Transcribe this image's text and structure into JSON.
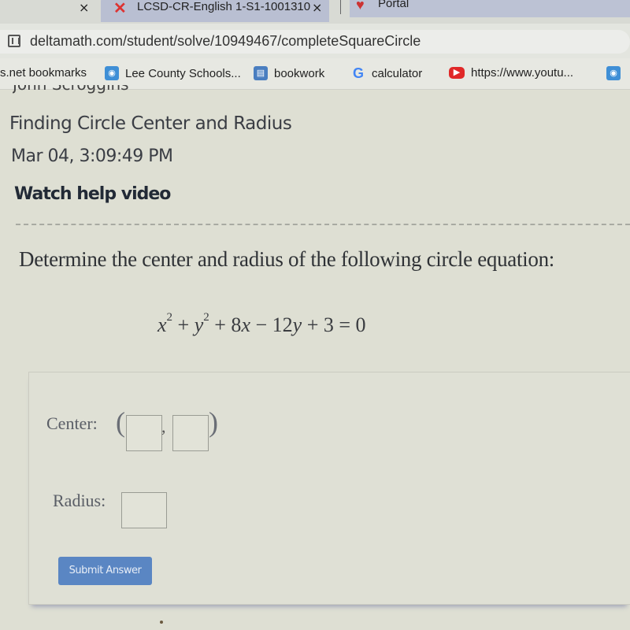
{
  "browser": {
    "tabs": [
      {
        "label": "LCSD-CR-English 1-S1-1001310",
        "icon": "x-logo-icon",
        "active": true
      },
      {
        "label": "Portal",
        "icon": "portal-icon",
        "active": false
      }
    ],
    "tab_close_glyph": "×",
    "url": "deltamath.com/student/solve/10949467/completeSquareCircle",
    "bookmarks": [
      {
        "label": "s.net bookmarks",
        "icon": null
      },
      {
        "label": "Lee County Schools...",
        "icon": "blue-app-icon"
      },
      {
        "label": "bookwork",
        "icon": "film-icon"
      },
      {
        "label": "calculator",
        "icon": "google-icon"
      },
      {
        "label": "https://www.youtu...",
        "icon": "youtube-icon"
      }
    ]
  },
  "page": {
    "student_name": "John Scroggins",
    "assignment_title": "Finding Circle Center and Radius",
    "timestamp": "Mar 04, 3:09:49 PM",
    "help_link": "Watch help video",
    "prompt": "Determine the center and radius of the following circle equation:",
    "equation": {
      "x_var": "x",
      "y_var": "y",
      "exp": "2",
      "plus1": " + ",
      "term_8x_coef": " + 8",
      "minus12": " − 12",
      "rest": " + 3 = 0"
    },
    "answer": {
      "center_label": "Center:",
      "paren_open": "(",
      "comma": ",",
      "paren_close": ")",
      "radius_label": "Radius:",
      "center_x_value": "",
      "center_y_value": "",
      "radius_value": "",
      "submit_label": "Submit Answer"
    }
  }
}
